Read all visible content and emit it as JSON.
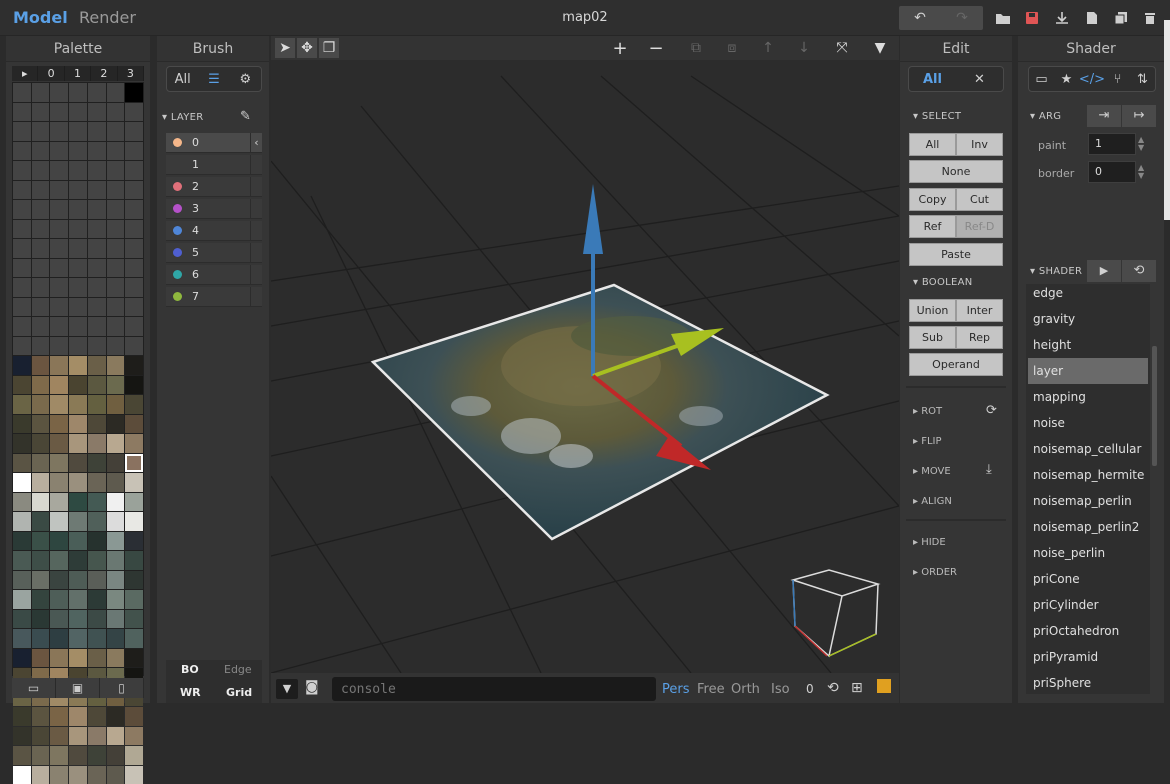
{
  "app": {
    "mode_model": "Model",
    "mode_render": "Render",
    "title": "map02"
  },
  "palette": {
    "header": "Palette",
    "tabs": [
      "▸",
      "0",
      "1",
      "2",
      "3"
    ],
    "footer_icons": [
      "folder-open-icon",
      "save-icon",
      "file-icon"
    ]
  },
  "brush": {
    "header": "Brush",
    "seg_all": "All",
    "section_layer": "LAYER",
    "layers": [
      "0",
      "1",
      "2",
      "3",
      "4",
      "5",
      "6",
      "7"
    ],
    "layer_colors": [
      "#f5b78a",
      "",
      "#e0707a",
      "#b551c9",
      "#4f86d8",
      "#4f5fd0",
      "#2fa6a6",
      "#8fb83e"
    ],
    "bo": "BO",
    "edge": "Edge",
    "wr": "WR",
    "grid": "Grid"
  },
  "viewport": {
    "console_placeholder": "console",
    "views": [
      "Pers",
      "Free",
      "Orth",
      "Iso"
    ],
    "zero": "0"
  },
  "edit": {
    "header": "Edit",
    "seg_all": "All",
    "select": "SELECT",
    "all": "All",
    "inv": "Inv",
    "none": "None",
    "copy": "Copy",
    "cut": "Cut",
    "ref": "Ref",
    "refd": "Ref-D",
    "paste": "Paste",
    "boolean": "BOOLEAN",
    "union": "Union",
    "inter": "Inter",
    "sub": "Sub",
    "rep": "Rep",
    "operand": "Operand",
    "rot": "ROT",
    "flip": "FLIP",
    "move": "MOVE",
    "align": "ALIGN",
    "hide": "HIDE",
    "order": "ORDER"
  },
  "shader": {
    "header": "Shader",
    "arg": "ARG",
    "paint_label": "paint",
    "paint_value": "1",
    "border_label": "border",
    "border_value": "0",
    "section": "SHADER",
    "items": [
      "edge",
      "gravity",
      "height",
      "layer",
      "mapping",
      "noise",
      "noisemap_cellular",
      "noisemap_hermite",
      "noisemap_perlin",
      "noisemap_perlin2",
      "noise_perlin",
      "priCone",
      "priCylinder",
      "priOctahedron",
      "priPyramid",
      "priSphere"
    ],
    "selected": "layer"
  },
  "colors": {
    "accent": "#5aa0e6"
  }
}
